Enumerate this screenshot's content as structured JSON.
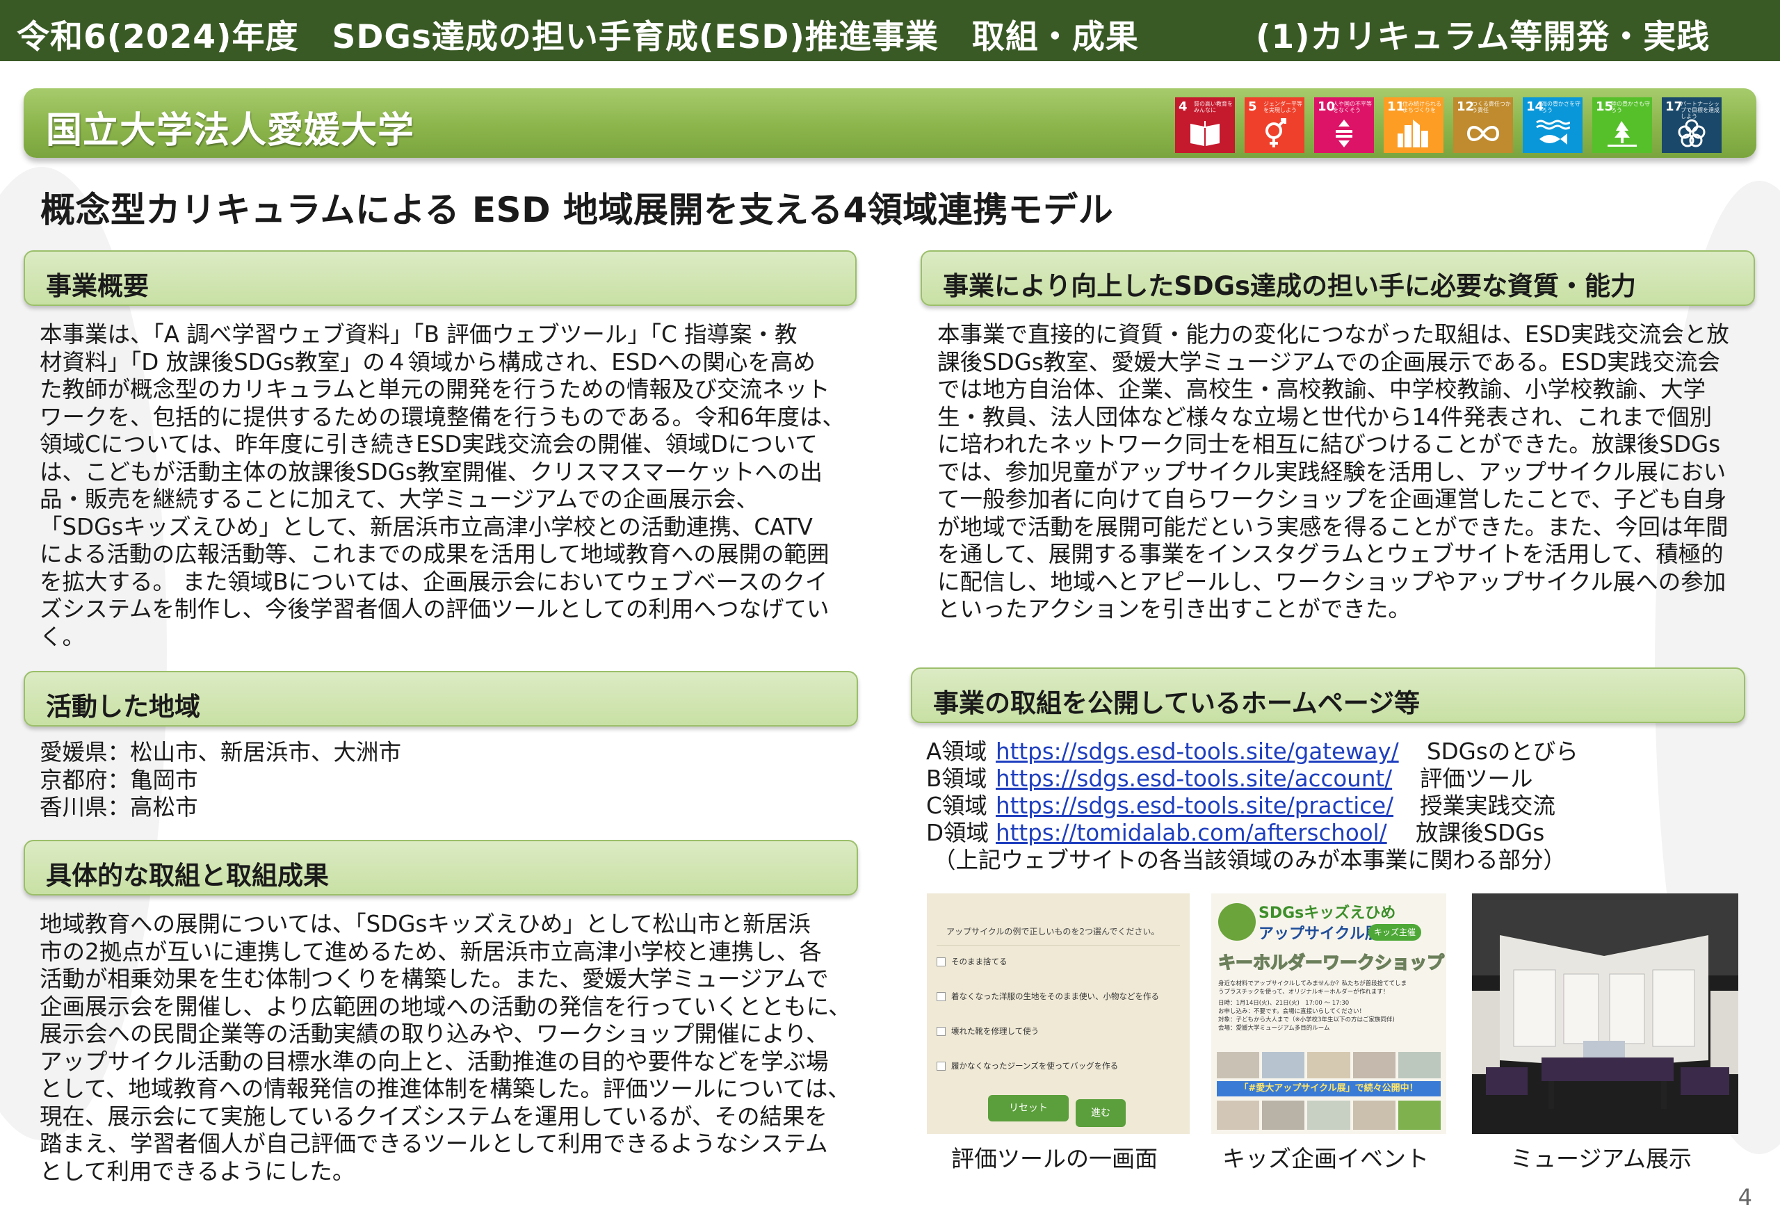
{
  "header": {
    "left_title": "令和6(2024)年度　SDGs達成の担い手育成(ESD)推進事業　取組・成果",
    "right_title": "(1)カリキュラム等開発・実践"
  },
  "university": "国立大学法人愛媛大学",
  "sdg_goals": [
    {
      "number": "4",
      "color": "#c5192d",
      "label": "質の高い教育をみんなに"
    },
    {
      "number": "5",
      "color": "#ef402b",
      "label": "ジェンダー平等を実現しよう"
    },
    {
      "number": "10",
      "color": "#dd1367",
      "label": "人や国の不平等をなくそう"
    },
    {
      "number": "11",
      "color": "#fd9d24",
      "label": "住み続けられるまちづくりを"
    },
    {
      "number": "12",
      "color": "#bf8b2e",
      "label": "つくる責任つかう責任"
    },
    {
      "number": "14",
      "color": "#0a97d9",
      "label": "海の豊かさを守ろう"
    },
    {
      "number": "15",
      "color": "#56c02b",
      "label": "陸の豊かさも守ろう"
    },
    {
      "number": "17",
      "color": "#19486a",
      "label": "パートナーシップで目標を達成しよう"
    }
  ],
  "main_title": "概念型カリキュラムによる ESD 地域展開を支える4領域連携モデル",
  "sections": {
    "overview": {
      "title": "事業概要",
      "lines": [
        "本事業は、「A 調べ学習ウェブ資料」「B 評価ウェブツール」「C 指導案・教",
        "材資料」「D 放課後SDGs教室」の４領域から構成され、ESDへの関心を高め",
        "た教師が概念型のカリキュラムと単元の開発を行うための情報及び交流ネット",
        "ワークを、包括的に提供するための環境整備を行うものである。令和6年度は、",
        "領域Cについては、昨年度に引き続きESD実践交流会の開催、領域Dについて",
        "は、こどもが活動主体の放課後SDGs教室開催、クリスマスマーケットへの出",
        "品・販売を継続することに加えて、大学ミュージアムでの企画展示会、",
        "「SDGsキッズえひめ」として、新居浜市立高津小学校との活動連携、CATV",
        "による活動の広報活動等、これまでの成果を活用して地域教育への展開の範囲",
        "を拡大する。 また領域Bについては、企画展示会においてウェブベースのクイ",
        "ズシステムを制作し、今後学習者個人の評価ツールとしての利用へつなげてい",
        "く。"
      ]
    },
    "regions": {
      "title": "活動した地域",
      "lines": [
        "愛媛県：松山市、新居浜市、大洲市",
        "京都府：亀岡市",
        "香川県：高松市"
      ]
    },
    "results": {
      "title": "具体的な取組と取組成果",
      "lines": [
        "地域教育への展開については、「SDGsキッズえひめ」として松山市と新居浜",
        "市の2拠点が互いに連携して進めるため、新居浜市立高津小学校と連携し、各",
        "活動が相乗効果を生む体制つくりを構築した。また、愛媛大学ミュージアムで",
        "企画展示会を開催し、より広範囲の地域への活動の発信を行っていくとともに、",
        "展示会への民間企業等の活動実績の取り込みや、ワークショップ開催により、",
        "アップサイクル活動の目標水準の向上と、活動推進の目的や要件などを学ぶ場",
        "として、地域教育への情報発信の推進体制を構築した。評価ツールについては、",
        "現在、展示会にて実施しているクイズシステムを運用しているが、その結果を",
        "踏まえ、学習者個人が自己評価できるツールとして利用できるようなシステム",
        "として利用できるようにした。"
      ]
    },
    "abilities": {
      "title": "事業により向上したSDGs達成の担い手に必要な資質・能力",
      "lines": [
        "本事業で直接的に資質・能力の変化につながった取組は、ESD実践交流会と放",
        "課後SDGs教室、愛媛大学ミュージアムでの企画展示である。ESD実践交流会",
        "では地方自治体、企業、高校生・高校教諭、中学校教諭、小学校教諭、大学",
        "生・教員、法人団体など様々な立場と世代から14件発表され、これまで個別",
        "に培われたネットワーク同士を相互に結びつけることができた。放課後SDGs",
        "では、参加児童がアップサイクル実践経験を活用し、アップサイクル展におい",
        "て一般参加者に向けて自らワークショップを企画運営したことで、子ども自身",
        "が地域で活動を展開可能だという実感を得ることができた。また、今回は年間",
        "を通して、展開する事業をインスタグラムとウェブサイトを活用して、積極的",
        "に配信し、地域へとアピールし、ワークショップやアップサイクル展への参加",
        "といったアクションを引き出すことができた。"
      ]
    },
    "homepage": {
      "title": "事業の取組を公開しているホームページ等",
      "links": [
        {
          "domain": "A領域",
          "url": "https://sdgs.esd-tools.site/gateway/",
          "desc": "SDGsのとびら"
        },
        {
          "domain": "B領域",
          "url": "https://sdgs.esd-tools.site/account/",
          "desc": "評価ツール"
        },
        {
          "domain": "C領域",
          "url": "https://sdgs.esd-tools.site/practice/",
          "desc": "授業実践交流"
        },
        {
          "domain": "D領域",
          "url": "https://tomidalab.com/afterschool/",
          "desc": "放課後SDGs"
        }
      ],
      "note": "（上記ウェブサイトの各当該領域のみが本事業に関わる部分）"
    }
  },
  "photos": {
    "quiz": {
      "caption": "評価ツールの一画面",
      "question": "アップサイクルの例で正しいものを2つ選んでください。",
      "options": [
        "そのまま捨てる",
        "着なくなった洋服の生地をそのまま使い、小物などを作る",
        "壊れた靴を修理して使う",
        "履かなくなったジーンズを使ってバッグを作る"
      ],
      "reset_label": "リセット",
      "next_label": "進む"
    },
    "event": {
      "caption": "キッズ企画イベント",
      "brand": "SDGsキッズえひめ",
      "title": "アップサイクル展",
      "badge": "キッズ主催",
      "subtitle": "キーホルダーワークショップ",
      "lines": [
        "身近な材料でアップサイクルしてみませんか？私たちが普段捨ててしま",
        "うプラスチックを使って、オリジナルキーホルダーが作れます！",
        "日時：1月14日(火)、21日(火)　17:00 〜 17:30",
        "お申し込み：不要です。会場に直接いらしてください！",
        "対象：子どもから大人まで（※小学校3年生以下の方はご家族同伴)",
        "会場：愛媛大学ミュージアム多目的ルーム"
      ],
      "banner": "「#愛大アップサイクル展」で続々公開中！"
    },
    "museum": {
      "caption": "ミュージアム展示"
    }
  },
  "page_number": "4"
}
